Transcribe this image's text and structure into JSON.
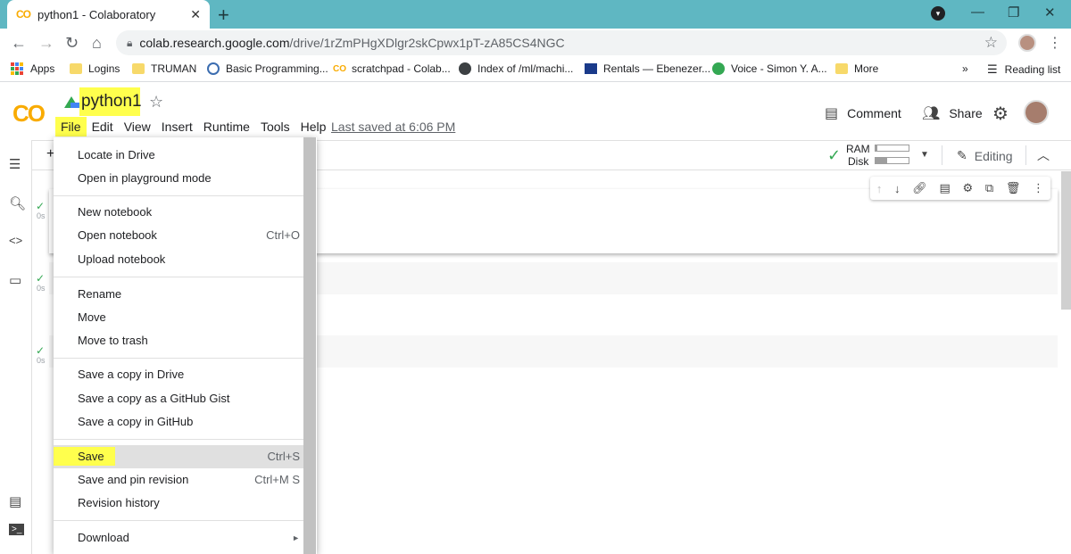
{
  "browser": {
    "tab_title": "python1 - Colaboratory",
    "tab_favicon": "CO",
    "url_host": "colab.research.google.com",
    "url_path": "/drive/1rZmPHgXDlgr2skCpwx1pT-zA85CS4NGC"
  },
  "bookmarks": [
    {
      "label": "Apps",
      "icon": "apps-grid-icon"
    },
    {
      "label": "Logins",
      "icon": "folder-icon"
    },
    {
      "label": "TRUMAN",
      "icon": "folder-icon"
    },
    {
      "label": "Basic Programming...",
      "icon": "c-icon"
    },
    {
      "label": "scratchpad - Colab...",
      "icon": "colab-icon"
    },
    {
      "label": "Index of /ml/machi...",
      "icon": "globe-icon"
    },
    {
      "label": "Rentals — Ebenezer...",
      "icon": "rentals-icon"
    },
    {
      "label": "Voice - Simon Y. A...",
      "icon": "phone-icon"
    },
    {
      "label": "More",
      "icon": "folder-icon"
    }
  ],
  "bookmarks_overflow": "»",
  "reading_list": "Reading list",
  "colab": {
    "logo": "CO",
    "notebook_title": "python1",
    "menus": [
      "File",
      "Edit",
      "View",
      "Insert",
      "Runtime",
      "Tools",
      "Help"
    ],
    "last_saved": "Last saved at 6:06 PM",
    "comment_label": "Comment",
    "share_label": "Share",
    "add_label": "+",
    "ram_label": "RAM",
    "disk_label": "Disk",
    "ram_usage": 0.05,
    "disk_usage": 0.35,
    "editing_label": "Editing"
  },
  "cells": [
    {
      "status": "✓",
      "time": "0s"
    },
    {
      "status": "✓",
      "time": "0s"
    },
    {
      "status": "✓",
      "time": "0s"
    }
  ],
  "file_menu": [
    {
      "label": "Locate in Drive",
      "shortcut": ""
    },
    {
      "label": "Open in playground mode",
      "shortcut": ""
    },
    {
      "label": "New notebook",
      "shortcut": ""
    },
    {
      "label": "Open notebook",
      "shortcut": "Ctrl+O"
    },
    {
      "label": "Upload notebook",
      "shortcut": ""
    },
    {
      "label": "Rename",
      "shortcut": ""
    },
    {
      "label": "Move",
      "shortcut": ""
    },
    {
      "label": "Move to trash",
      "shortcut": ""
    },
    {
      "label": "Save a copy in Drive",
      "shortcut": ""
    },
    {
      "label": "Save a copy as a GitHub Gist",
      "shortcut": ""
    },
    {
      "label": "Save a copy in GitHub",
      "shortcut": ""
    },
    {
      "label": "Save",
      "shortcut": "Ctrl+S"
    },
    {
      "label": "Save and pin revision",
      "shortcut": "Ctrl+M S"
    },
    {
      "label": "Revision history",
      "shortcut": ""
    },
    {
      "label": "Download",
      "shortcut": "►"
    }
  ],
  "colors": {
    "tabstrip": "#5fb7c2",
    "highlight": "#ffff4d",
    "colab_orange": "#f9ab00",
    "check_green": "#34a853"
  }
}
